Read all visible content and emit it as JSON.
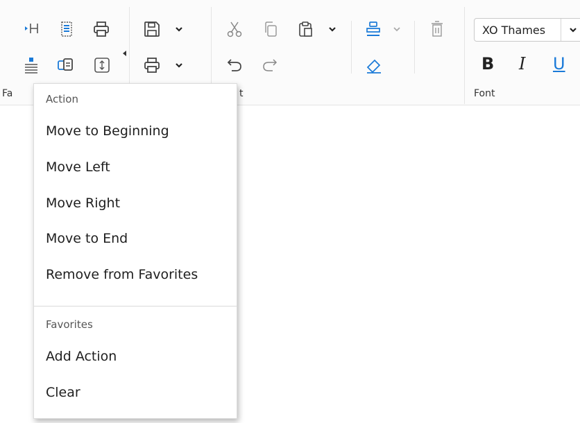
{
  "ribbon": {
    "groups": {
      "favorites_label": "Fa",
      "edit_label": "t",
      "font_label": "Font"
    },
    "icons": [
      "insert-row-icon",
      "select-block-icon",
      "print-icon",
      "save-icon",
      "print-dropdown-icon",
      "cut-icon",
      "copy-icon",
      "paste-icon",
      "paint-format-icon",
      "delete-icon",
      "align-text-icon",
      "insert-field-icon",
      "resize-icon",
      "undo-icon",
      "redo-icon",
      "eraser-icon"
    ],
    "font": {
      "name": "XO Thames"
    },
    "format": {
      "bold": "B",
      "italic": "I",
      "underline": "U"
    },
    "accent_color": "#1a7ad8"
  },
  "menu": {
    "action_header": "Action",
    "action_items": [
      "Move to Beginning",
      "Move Left",
      "Move Right",
      "Move to End",
      "Remove from Favorites"
    ],
    "favorites_header": "Favorites",
    "favorites_items": [
      "Add Action",
      "Clear"
    ]
  }
}
